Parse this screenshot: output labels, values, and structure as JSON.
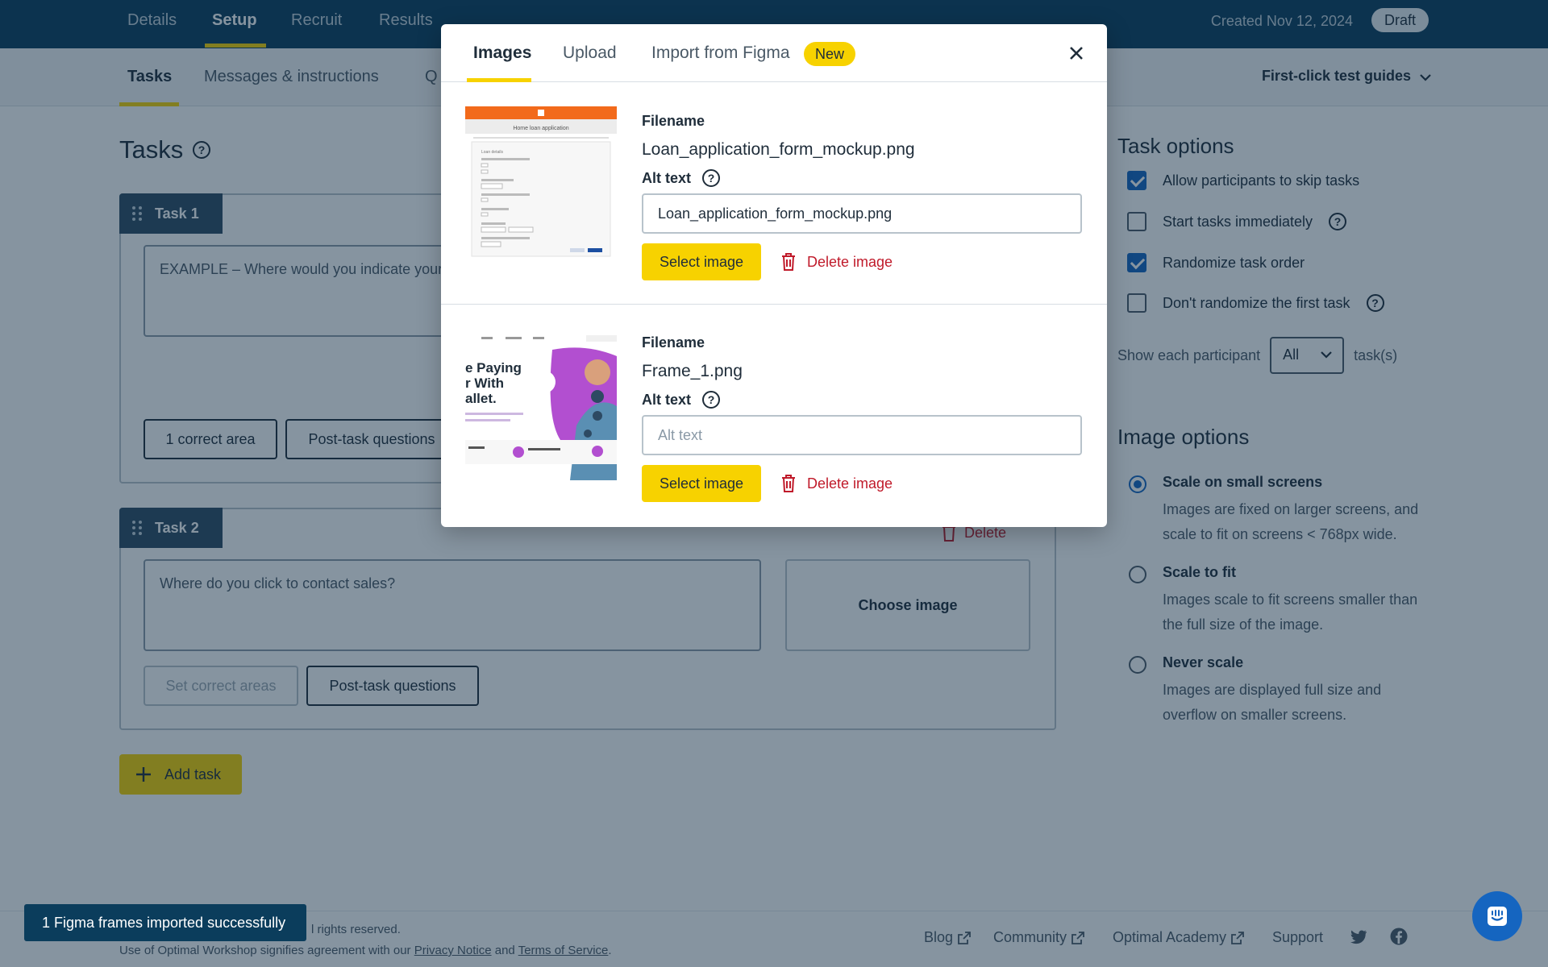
{
  "topnav": {
    "tabs": [
      {
        "label": "Details"
      },
      {
        "label": "Setup"
      },
      {
        "label": "Recruit"
      },
      {
        "label": "Results"
      }
    ],
    "created": "Created Nov 12, 2024",
    "status_badge": "Draft"
  },
  "subnav": {
    "tabs": [
      {
        "label": "Tasks"
      },
      {
        "label": "Messages & instructions"
      },
      {
        "label": "Q"
      }
    ],
    "guides": "First-click test guides"
  },
  "main": {
    "title": "Tasks",
    "task1": {
      "label": "Task 1",
      "text": "EXAMPLE – Where would you indicate your",
      "correct_area": "1 correct area",
      "post_task": "Post-task questions"
    },
    "task2": {
      "label": "Task 2",
      "text": "Where do you click to contact sales?",
      "choose_image": "Choose image",
      "delete": "Delete",
      "set_correct": "Set correct areas",
      "post_task": "Post-task questions"
    },
    "add_task": "Add task"
  },
  "sidebar": {
    "task_options_title": "Task options",
    "options": [
      {
        "label": "Allow participants to skip tasks",
        "checked": true
      },
      {
        "label": "Start tasks immediately",
        "checked": false
      },
      {
        "label": "Randomize task order",
        "checked": true
      },
      {
        "label": "Don't randomize the first task",
        "checked": false
      }
    ],
    "show_each": "Show each participant",
    "show_each_value": "All",
    "show_each_suffix": "task(s)",
    "image_options_title": "Image options",
    "image_options": [
      {
        "title": "Scale on small screens",
        "desc": "Images are fixed on larger screens, and scale to fit on screens < 768px wide.",
        "selected": true
      },
      {
        "title": "Scale to fit",
        "desc": "Images scale to fit screens smaller than the full size of the image.",
        "selected": false
      },
      {
        "title": "Never scale",
        "desc": "Images are displayed full size and overflow on smaller screens.",
        "selected": false
      }
    ]
  },
  "modal": {
    "tabs": [
      {
        "label": "Images"
      },
      {
        "label": "Upload"
      },
      {
        "label": "Import from Figma"
      }
    ],
    "new_badge": "New",
    "filename_label": "Filename",
    "alt_label": "Alt text",
    "images": [
      {
        "filename": "Loan_application_form_mockup.png",
        "alt_value": "Loan_application_form_mockup.png",
        "alt_placeholder": "Alt text"
      },
      {
        "filename": "Frame_1.png",
        "alt_value": "",
        "alt_placeholder": "Alt text"
      }
    ],
    "select_label": "Select image",
    "delete_label": "Delete image",
    "thumb1": {
      "title": "Home loan application",
      "section": "Loan details"
    },
    "thumb2": {
      "line1": "e Paying",
      "line2": "r With",
      "line3": "allet."
    }
  },
  "footer": {
    "rights": "l rights reserved.",
    "legal_prefix": "Use of Optimal Workshop signifies agreement with our",
    "privacy": "Privacy Notice",
    "and": "and",
    "terms": "Terms of Service",
    "period": ".",
    "links": [
      {
        "label": "Blog"
      },
      {
        "label": "Community"
      },
      {
        "label": "Optimal Academy"
      },
      {
        "label": "Support"
      }
    ]
  },
  "toast": "1 Figma frames imported successfully",
  "colors": {
    "navy": "#0b3d5c",
    "accent_yellow": "#f7d200",
    "primary_blue": "#1565c0",
    "danger_red": "#c01a2a"
  }
}
